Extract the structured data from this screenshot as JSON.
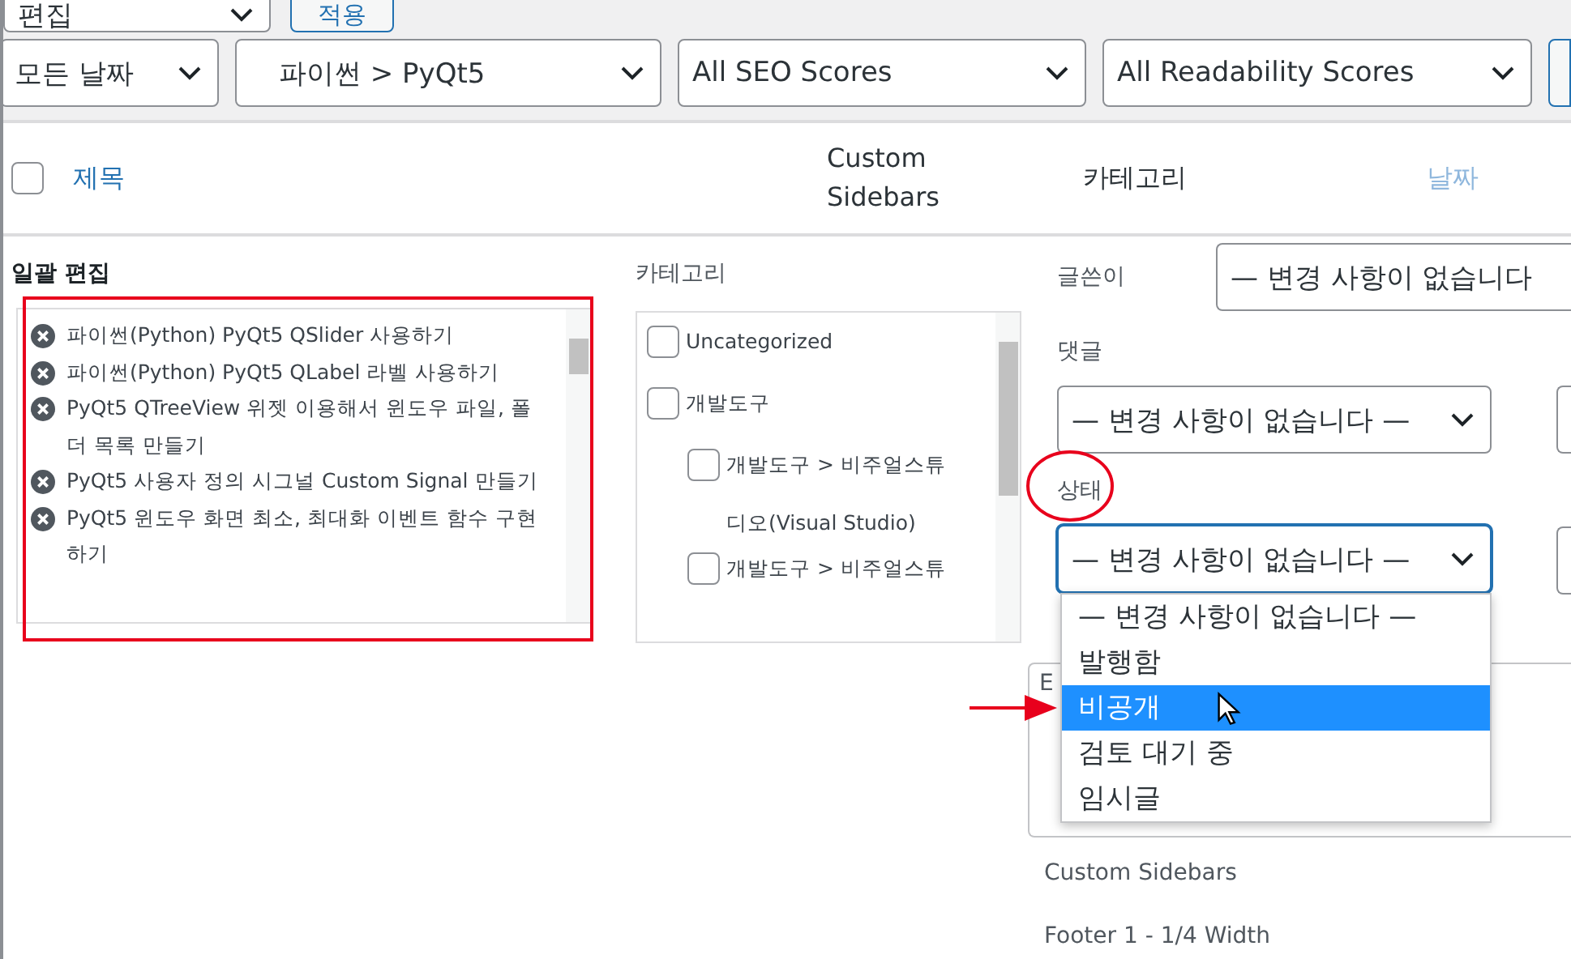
{
  "bulk_action": {
    "value": "편집",
    "button": "적용"
  },
  "filters": [
    {
      "value": "모든 날짜"
    },
    {
      "value": "파이썬 > PyQt5"
    },
    {
      "value": "All SEO Scores"
    },
    {
      "value": "All Readability Scores"
    }
  ],
  "header": {
    "checked": false,
    "columns": [
      {
        "label": "제목",
        "kind": "link"
      },
      {
        "label": "Custom Sidebars",
        "kind": "plain"
      },
      {
        "label": "카테고리",
        "kind": "plain"
      },
      {
        "label": "날짜",
        "kind": "link"
      }
    ]
  },
  "bulk_edit": {
    "title": "일괄 편집",
    "posts": [
      "파이썬(Python) PyQt5 QSlider 사용하기",
      "파이썬(Python) PyQt5 QLabel 라벨 사용하기",
      "PyQt5 QTreeView 위젯 이용해서 윈도우 파일, 폴더 목록 만들기",
      "PyQt5 사용자 정의 시그널 Custom Signal 만들기",
      "PyQt5 윈도우 화면 최소, 최대화 이벤트 함수 구현하기"
    ]
  },
  "categories": {
    "label": "카테고리",
    "items": [
      {
        "label": "Uncategorized",
        "checked": false
      },
      {
        "label": "개발도구",
        "checked": false,
        "children": [
          {
            "label": "개발도구 > 비주얼스튜디오(Visual Studio)",
            "checked": false
          },
          {
            "label": "개발도구 > 비주얼스튜",
            "checked": false
          }
        ]
      }
    ]
  },
  "author": {
    "label": "글쓴이",
    "value": "— 변경 사항이 없습니다"
  },
  "comments": {
    "label": "댓글",
    "value": "— 변경 사항이 없습니다 —"
  },
  "status": {
    "label": "상태",
    "value": "— 변경 사항이 없습니다 —",
    "open": true,
    "options": [
      {
        "label": "— 변경 사항이 없습니다 —",
        "highlighted": false
      },
      {
        "label": "발행함",
        "highlighted": false
      },
      {
        "label": "비공개",
        "highlighted": true
      },
      {
        "label": "검토 대기 중",
        "highlighted": false
      },
      {
        "label": "임시글",
        "highlighted": false
      }
    ]
  },
  "fieldset_label": "E",
  "sidebars": {
    "label": "Custom Sidebars",
    "value": "Footer 1 - 1/4 Width"
  }
}
